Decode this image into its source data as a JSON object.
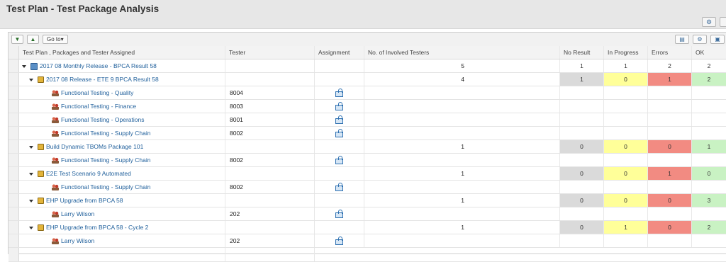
{
  "page": {
    "title": "Test Plan - Test Package Analysis"
  },
  "toolbar": {
    "expand_icon": "expand-all-icon",
    "collapse_icon": "collapse-all-icon",
    "goto_label": "Go to"
  },
  "columns": {
    "name": "Test Plan , Packages and Tester Assigned",
    "tester": "Tester",
    "assignment": "Assignment",
    "involved": "No. of Involved Testers",
    "no_result": "No Result",
    "in_progress": "In Progress",
    "errors": "Errors",
    "ok": "OK"
  },
  "colors": {
    "gray": "#dadada",
    "yellow": "#ffff99",
    "red": "#f28b82",
    "green": "#c9f2c3",
    "link": "#1f5f9b"
  },
  "rows": [
    {
      "level": 0,
      "type": "plan",
      "name": "2017 08 Monthly Release - BPCA Result 58",
      "involved": "5",
      "no_result": "1",
      "in_progress": "1",
      "errors": "2",
      "ok": "2",
      "colored": false
    },
    {
      "level": 1,
      "type": "pkg",
      "name": "2017 08 Release -  ETE 9   BPCA Result 58",
      "involved": "4",
      "no_result": "1",
      "in_progress": "0",
      "errors": "1",
      "ok": "2",
      "colored": true
    },
    {
      "level": 2,
      "type": "tester",
      "name": "Functional Testing -  Quality",
      "tester": "8004"
    },
    {
      "level": 2,
      "type": "tester",
      "name": "Functional Testing - Finance",
      "tester": "8003"
    },
    {
      "level": 2,
      "type": "tester",
      "name": "Functional Testing - Operations",
      "tester": "8001"
    },
    {
      "level": 2,
      "type": "tester",
      "name": "Functional Testing - Supply Chain",
      "tester": "8002"
    },
    {
      "level": 1,
      "type": "pkg",
      "name": "Build Dynamic TBOMs Package 101",
      "involved": "1",
      "no_result": "0",
      "in_progress": "0",
      "errors": "0",
      "ok": "1",
      "colored": true
    },
    {
      "level": 2,
      "type": "tester",
      "name": "Functional Testing - Supply Chain",
      "tester": "8002"
    },
    {
      "level": 1,
      "type": "pkg",
      "name": "E2E Test Scenario 9 Automated",
      "involved": "1",
      "no_result": "0",
      "in_progress": "0",
      "errors": "1",
      "ok": "0",
      "colored": true
    },
    {
      "level": 2,
      "type": "tester",
      "name": "Functional Testing - Supply Chain",
      "tester": "8002"
    },
    {
      "level": 1,
      "type": "pkg",
      "name": "EHP Upgrade from BPCA 58",
      "involved": "1",
      "no_result": "0",
      "in_progress": "0",
      "errors": "0",
      "ok": "3",
      "colored": true
    },
    {
      "level": 2,
      "type": "tester",
      "name": "Larry Wilson",
      "tester": "202"
    },
    {
      "level": 1,
      "type": "pkg",
      "name": "EHP Upgrade from BPCA 58 - Cycle 2",
      "involved": "1",
      "no_result": "0",
      "in_progress": "1",
      "errors": "0",
      "ok": "2",
      "colored": true
    },
    {
      "level": 2,
      "type": "tester",
      "name": "Larry Wilson",
      "tester": "202"
    }
  ]
}
